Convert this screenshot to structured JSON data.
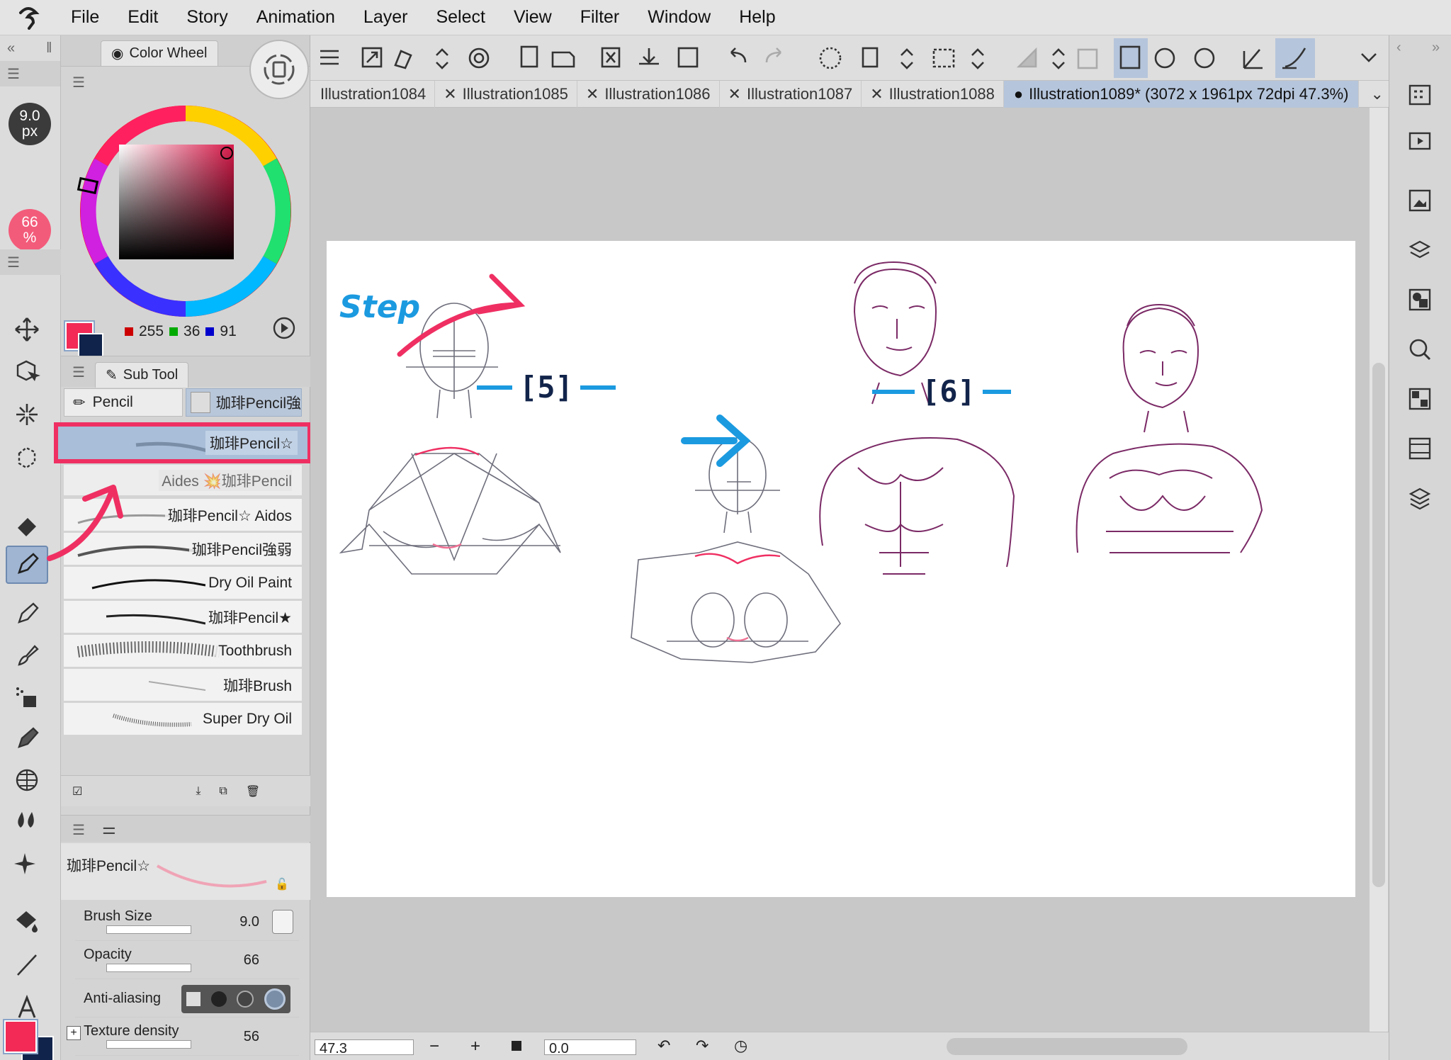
{
  "menu": [
    "File",
    "Edit",
    "Story",
    "Animation",
    "Layer",
    "Select",
    "View",
    "Filter",
    "Window",
    "Help"
  ],
  "left": {
    "brush_size_value": "9.0",
    "brush_size_unit": "px",
    "opacity_value": "66",
    "opacity_unit": "%"
  },
  "color_wheel": {
    "tab_label": "Color Wheel",
    "r": "255",
    "g": "36",
    "b": "91",
    "main_color": "#f22a55",
    "sub_color": "#10234a"
  },
  "subtool": {
    "tab_label": "Sub Tool",
    "group_tabs": [
      "Pencil",
      "珈琲Pencil強"
    ],
    "brushes": [
      {
        "label": "珈琲Pencil☆",
        "selected": true
      },
      {
        "label": "Aides 💥珈琲Pencil"
      },
      {
        "label": "珈琲Pencil☆ Aidos"
      },
      {
        "label": "珈琲Pencil強弱"
      },
      {
        "label": "Dry Oil Paint"
      },
      {
        "label": "珈琲Pencil★"
      },
      {
        "label": "Toothbrush"
      },
      {
        "label": "珈琲Brush"
      },
      {
        "label": "Super Dry Oil"
      }
    ]
  },
  "tool_property": {
    "preview_name": "珈琲Pencil☆",
    "rows": [
      {
        "label": "Brush Size",
        "value": "9.0"
      },
      {
        "label": "Opacity",
        "value": "66"
      },
      {
        "label": "Anti-aliasing",
        "value": ""
      },
      {
        "label": "Texture density",
        "value": "56"
      }
    ]
  },
  "doc_tabs": [
    "Illustration1084",
    "Illustration1085",
    "Illustration1086",
    "Illustration1087",
    "Illustration1088"
  ],
  "active_tab": "Illustration1089* (3072 x 1961px 72dpi 47.3%)",
  "canvas": {
    "step_title": "Step",
    "step5": "[5]",
    "step6": "[6]"
  },
  "status": {
    "zoom": "47.3",
    "rotation": "0.0"
  },
  "colors": {
    "accent_pink": "#ef2f62",
    "accent_blue": "#1b9ae0",
    "sketch_purple": "#7b2a66"
  }
}
